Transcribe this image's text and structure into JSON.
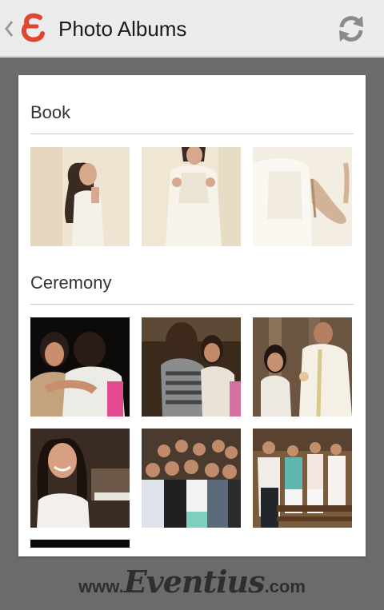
{
  "app": {
    "title": "Photo Albums",
    "logo_glyph": "ε",
    "logo_color": "#e0452f"
  },
  "icons": {
    "back": "chevron-left-icon",
    "refresh": "refresh-icon"
  },
  "albums": [
    {
      "title": "Book",
      "photos": [
        "girl in white dress, profile",
        "girl holding white gown",
        "white dress and beige shoes"
      ]
    },
    {
      "title": "Ceremony",
      "photos": [
        "two girls hugging",
        "girls embracing in church",
        "priest giving communion",
        "smiling girl portrait",
        "group photo of teenagers",
        "guests standing in church pews",
        "photo partially visible"
      ]
    }
  ],
  "footer": {
    "prefix": "www.",
    "brand": "Eventius",
    "suffix": ".com"
  }
}
